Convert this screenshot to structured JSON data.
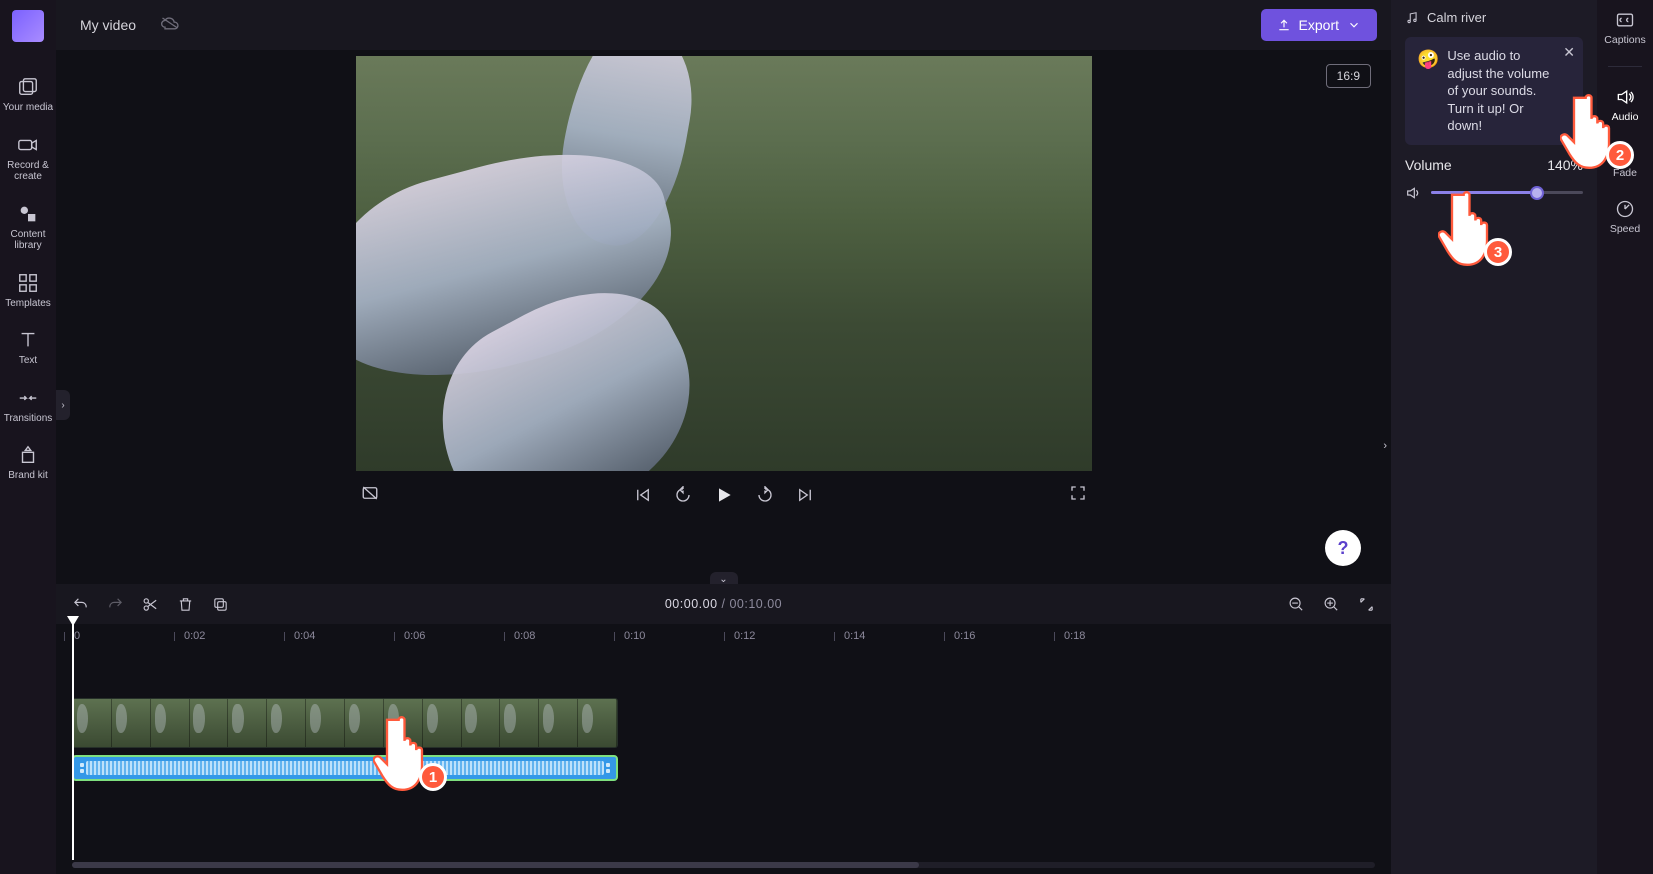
{
  "sidebar": {
    "items": [
      {
        "label": "Your media"
      },
      {
        "label": "Record & create"
      },
      {
        "label": "Content library"
      },
      {
        "label": "Templates"
      },
      {
        "label": "Text"
      },
      {
        "label": "Transitions"
      },
      {
        "label": "Brand kit"
      }
    ]
  },
  "topbar": {
    "project_name": "My video",
    "export_label": "Export"
  },
  "viewport": {
    "aspect_ratio": "16:9"
  },
  "timecode": {
    "current": "00:00.00",
    "duration": "00:10.00"
  },
  "ruler_ticks": [
    "0",
    "0:02",
    "0:04",
    "0:06",
    "0:08",
    "0:10",
    "0:12",
    "0:14",
    "0:16",
    "0:18"
  ],
  "right_panel": {
    "clip_name": "Calm river",
    "tip_text": "Use audio to adjust the volume of your sounds. Turn it up! Or down!",
    "volume_label": "Volume",
    "volume_value": "140%",
    "volume_fill_pct": 70
  },
  "tool_rail": {
    "captions": "Captions",
    "audio": "Audio",
    "fade": "Fade",
    "speed": "Speed"
  },
  "callouts": {
    "n1": "1",
    "n2": "2",
    "n3": "3"
  }
}
